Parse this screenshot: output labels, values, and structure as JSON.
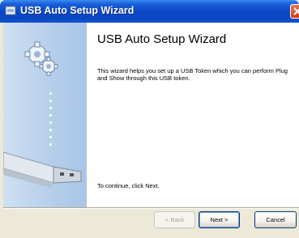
{
  "window": {
    "title": "USB Auto Setup Wizard",
    "title_icon": "usb-wizard-icon",
    "close_icon": "close-icon"
  },
  "left_panel": {
    "icons": [
      "gears-icon",
      "usb-drive-icon"
    ]
  },
  "content": {
    "heading": "USB Auto Setup Wizard",
    "description": "This wizard helps you set up a USB Token which you can perform Plug and Show through this USB token.",
    "continue_text": "To continue, click Next."
  },
  "buttons": {
    "back": "< Back",
    "next": "Next >",
    "cancel": "Cancel"
  },
  "colors": {
    "titlebar": "#0a46c2",
    "panel": "#b6cfea",
    "window_bg": "#ece9d8",
    "close": "#cc3a14"
  }
}
